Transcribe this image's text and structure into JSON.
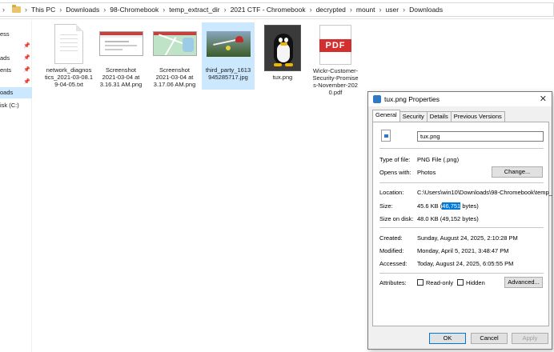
{
  "address": {
    "crumbs": [
      "This PC",
      "Downloads",
      "98-Chromebook",
      "temp_extract_dir",
      "2021 CTF - Chromebook",
      "decrypted",
      "mount",
      "user",
      "Downloads"
    ]
  },
  "nav": {
    "items": [
      {
        "label": "ess",
        "pinned": false
      },
      {
        "label": "",
        "pinned": true
      },
      {
        "label": "ads",
        "pinned": true
      },
      {
        "label": "ents",
        "pinned": true
      },
      {
        "label": "",
        "pinned": true
      },
      {
        "label": "oads",
        "pinned": false,
        "selected": true
      },
      {
        "label": "isk (C:)",
        "pinned": false
      }
    ]
  },
  "files": [
    {
      "name": "network_diagnostics_2021-03-08.19-04-05.txt",
      "lines": [
        "network_diagnos",
        "tics_2021-03-08.1",
        "9-04-05.txt"
      ]
    },
    {
      "name": "Screenshot 2021-03-04 at 3.16.31 AM.png",
      "lines": [
        "Screenshot",
        "2021-03-04 at",
        "3.16.31 AM.png"
      ]
    },
    {
      "name": "Screenshot 2021-03-04 at 3.17.06 AM.png",
      "lines": [
        "Screenshot",
        "2021-03-04 at",
        "3.17.06 AM.png"
      ]
    },
    {
      "name": "third_party_1613945285717.jpg",
      "lines": [
        "third_party_1613",
        "945285717.jpg"
      ]
    },
    {
      "name": "tux.png",
      "lines": [
        "tux.png"
      ]
    },
    {
      "name": "Wickr-Customer-Security-Promises-November-2020.pdf",
      "lines": [
        "Wickr-Customer-",
        "Security-Promise",
        "s-November-202",
        "0.pdf"
      ]
    }
  ],
  "pdf_badge": "PDF",
  "dialog": {
    "title": "tux.png Properties",
    "close": "✕",
    "tabs": [
      "General",
      "Security",
      "Details",
      "Previous Versions"
    ],
    "filename": "tux.png",
    "type_label": "Type of file:",
    "type_value": "PNG File (.png)",
    "opens_label": "Opens with:",
    "opens_value": "Photos",
    "change_btn": "Change...",
    "location_label": "Location:",
    "location_value": "C:\\Users\\win10\\Downloads\\98-Chromebook\\temp_",
    "size_label": "Size:",
    "size_prefix": "45.6 KB (",
    "size_selected": "46,751",
    "size_suffix": " bytes)",
    "disk_label": "Size on disk:",
    "disk_value": "48.0 KB (49,152 bytes)",
    "created_label": "Created:",
    "created_value": "Sunday, August 24, 2025, 2:10:28 PM",
    "modified_label": "Modified:",
    "modified_value": "Monday, April 5, 2021, 3:48:47 PM",
    "accessed_label": "Accessed:",
    "accessed_value": "Today, August 24, 2025, 6:05:55 PM",
    "attr_label": "Attributes:",
    "readonly_label": "Read-only",
    "hidden_label": "Hidden",
    "advanced_btn": "Advanced...",
    "ok_btn": "OK",
    "cancel_btn": "Cancel",
    "apply_btn": "Apply"
  },
  "colors": {
    "selection": "#cce8ff",
    "accent": "#0078d7",
    "pdf_red": "#d32f2f"
  }
}
